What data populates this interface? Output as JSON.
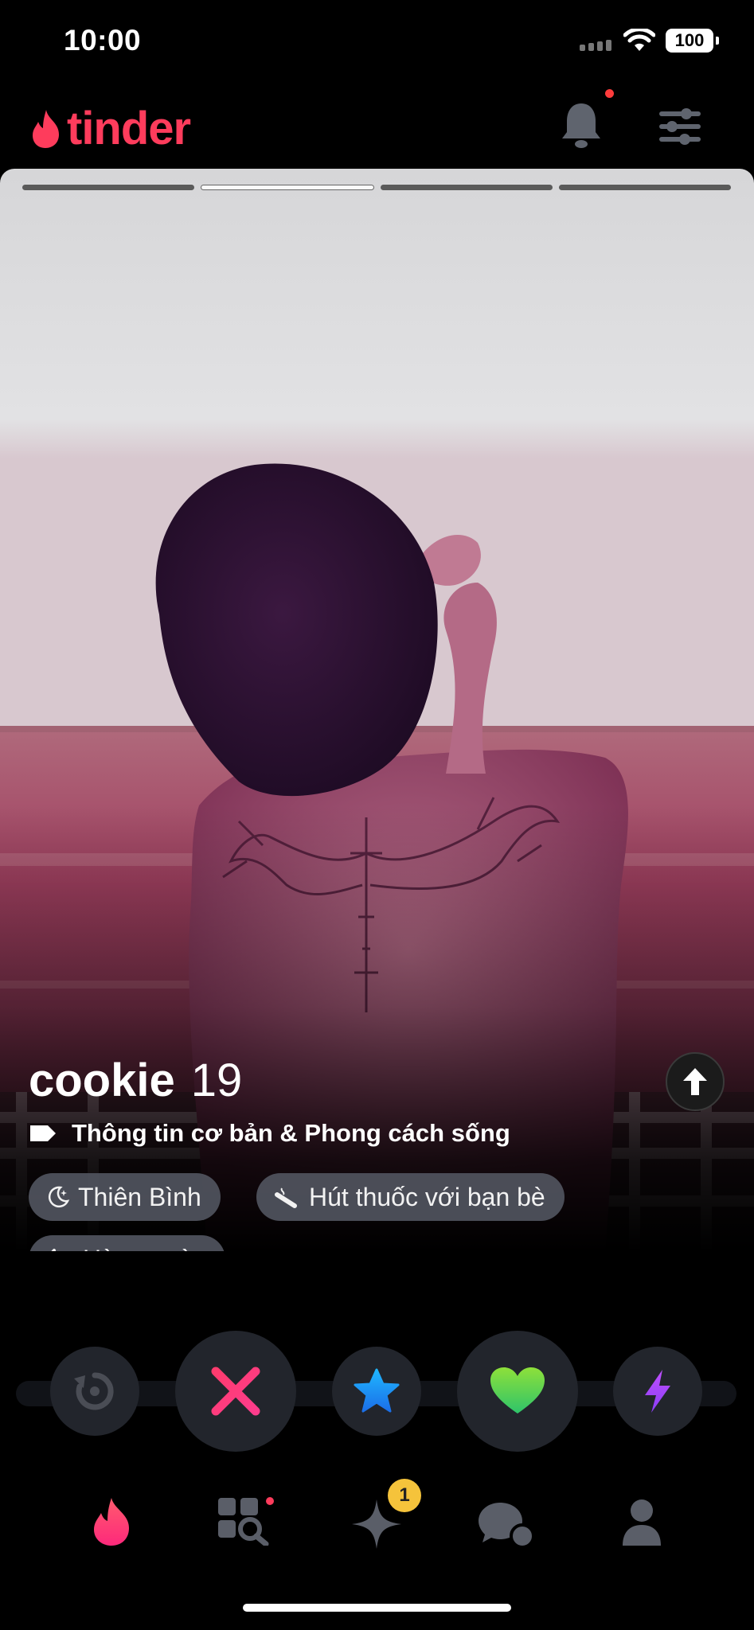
{
  "status_bar": {
    "time": "10:00",
    "battery": "100"
  },
  "header": {
    "logo_text": "tinder"
  },
  "card": {
    "photo_count": 4,
    "active_photo_index": 1,
    "name": "cookie",
    "age": "19",
    "info_label": "Thông tin cơ bản & Phong cách sống",
    "chips": [
      {
        "icon": "moon-icon",
        "label": "Thiên Bình"
      },
      {
        "icon": "smoking-icon",
        "label": "Hút thuốc với bạn bè"
      },
      {
        "icon": "dumbbell-icon",
        "label": "Hàng ngày"
      }
    ]
  },
  "actions": [
    {
      "name": "rewind-button",
      "icon": "rewind-icon",
      "color": "#4a4d55"
    },
    {
      "name": "nope-button",
      "icon": "x-icon",
      "color": "#fe3b7a"
    },
    {
      "name": "super-like-button",
      "icon": "star-icon",
      "color": "#1ea7ff"
    },
    {
      "name": "like-button",
      "icon": "heart-icon",
      "color": "#4dd64a"
    },
    {
      "name": "boost-button",
      "icon": "bolt-icon",
      "color": "#a64bff"
    }
  ],
  "nav": {
    "items": [
      "home-flame-icon",
      "explore-icon",
      "likes-sparkle-icon",
      "chat-icon",
      "profile-icon"
    ],
    "likes_badge": "1"
  },
  "colors": {
    "brand": "#fe3c5c",
    "chip_bg": "#50545e",
    "background": "#000000"
  }
}
